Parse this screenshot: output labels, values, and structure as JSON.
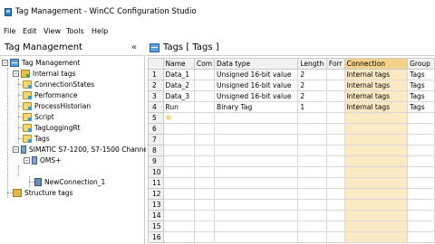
{
  "window": {
    "title": "Tag Management - WinCC Configuration Studio"
  },
  "menu": {
    "items": [
      "File",
      "Edit",
      "View",
      "Tools",
      "Help"
    ]
  },
  "left_panel": {
    "title": "Tag Management",
    "collapse_glyph": "«",
    "tree": [
      {
        "label": "Tag Management",
        "icon": "grid-icon",
        "expander": "−"
      },
      {
        "label": "Internal tags",
        "icon": "tag-folder-icon",
        "expander": "−"
      },
      {
        "label": "ConnectionStates",
        "icon": "tag-group-icon"
      },
      {
        "label": "Performance",
        "icon": "tag-group-icon"
      },
      {
        "label": "ProcessHistorian",
        "icon": "tag-group-icon"
      },
      {
        "label": "Script",
        "icon": "tag-group-icon"
      },
      {
        "label": "TagLoggingRt",
        "icon": "tag-group-icon"
      },
      {
        "label": "Tags",
        "icon": "tag-group-icon"
      },
      {
        "label": "SIMATIC S7-1200, S7-1500 Channel",
        "icon": "plc-icon",
        "expander": "−"
      },
      {
        "label": "OMS+",
        "icon": "plc-icon",
        "expander": "−"
      },
      {
        "label": "NewConnection_1",
        "icon": "connection-icon"
      },
      {
        "label": "Structure tags",
        "icon": "structure-icon"
      }
    ]
  },
  "right_panel": {
    "title": "Tags [ Tags ]",
    "columns": [
      "",
      "Name",
      "Com",
      "Data type",
      "Length",
      "Forr",
      "Connection",
      "Group"
    ],
    "rows": [
      [
        "1",
        "Data_1",
        "",
        "Unsigned 16-bit value",
        "2",
        "",
        "Internal tags",
        "Tags"
      ],
      [
        "2",
        "Data_2",
        "",
        "Unsigned 16-bit value",
        "2",
        "",
        "Internal tags",
        "Tags"
      ],
      [
        "3",
        "Data_3",
        "",
        "Unsigned 16-bit value",
        "2",
        "",
        "Internal tags",
        "Tags"
      ],
      [
        "4",
        "Run",
        "",
        "Binary Tag",
        "1",
        "",
        "Internal tags",
        "Tags"
      ],
      [
        "5",
        "",
        "",
        "",
        "",
        "",
        "",
        ""
      ],
      [
        "6",
        "",
        "",
        "",
        "",
        "",
        "",
        ""
      ],
      [
        "7",
        "",
        "",
        "",
        "",
        "",
        "",
        ""
      ],
      [
        "8",
        "",
        "",
        "",
        "",
        "",
        "",
        ""
      ],
      [
        "9",
        "",
        "",
        "",
        "",
        "",
        "",
        ""
      ],
      [
        "10",
        "",
        "",
        "",
        "",
        "",
        "",
        ""
      ],
      [
        "11",
        "",
        "",
        "",
        "",
        "",
        "",
        ""
      ],
      [
        "12",
        "",
        "",
        "",
        "",
        "",
        "",
        ""
      ],
      [
        "13",
        "",
        "",
        "",
        "",
        "",
        "",
        ""
      ],
      [
        "14",
        "",
        "",
        "",
        "",
        "",
        "",
        ""
      ],
      [
        "15",
        "",
        "",
        "",
        "",
        "",
        "",
        ""
      ],
      [
        "16",
        "",
        "",
        "",
        "",
        "",
        "",
        ""
      ]
    ],
    "new_row_glyph": "✲"
  }
}
